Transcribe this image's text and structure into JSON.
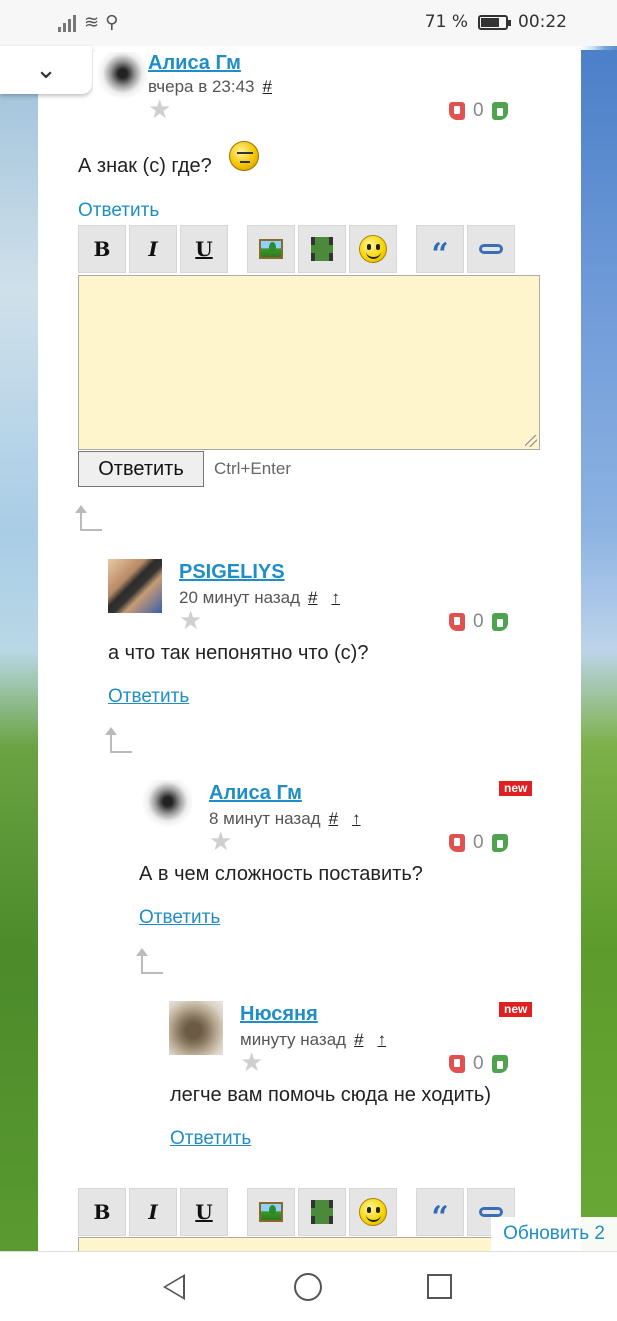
{
  "status_bar": {
    "battery_percent": "71 %",
    "time": "00:22",
    "battery_level": 0.71
  },
  "comments": [
    {
      "author": "Алиса Гм",
      "time": "вчера в 23:43",
      "anchor": "#",
      "up": "",
      "rating": "0",
      "text": "А знак  (с) где?",
      "reply": "Ответить",
      "new": ""
    },
    {
      "author": "PSIGELIYS",
      "time": "20 минут назад",
      "anchor": "#",
      "up": "↑",
      "rating": "0",
      "text": "а что так непонятно что (с)?",
      "reply": "Ответить",
      "new": ""
    },
    {
      "author": "Алиса Гм",
      "time": "8 минут назад",
      "anchor": "#",
      "up": "↑",
      "rating": "0",
      "text": "А в чем сложность поставить?",
      "reply": "Ответить",
      "new": "new"
    },
    {
      "author": "Нюсяня",
      "time": "минуту назад",
      "anchor": "#",
      "up": "↑",
      "rating": "0",
      "text": "легче вам помочь сюда не ходить)",
      "reply": "Ответить",
      "new": "new"
    }
  ],
  "editor": {
    "toolbar": {
      "bold": "B",
      "italic": "I",
      "underline": "U",
      "quote": "“"
    },
    "submit_label": "Ответить",
    "hint": "Ctrl+Enter"
  },
  "refresh_label": "Обновить 2",
  "icons": {
    "collapse": "chevron-down-icon",
    "nav": [
      "nav-back-icon",
      "nav-home-icon",
      "nav-recent-icon"
    ]
  },
  "colors": {
    "link": "#1f8ec6",
    "editor_bg": "#fff5cc",
    "new_badge": "#e02020"
  }
}
